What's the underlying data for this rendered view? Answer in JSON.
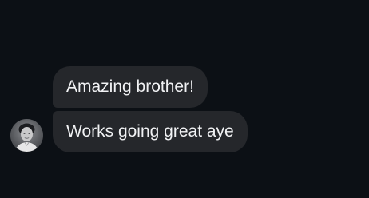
{
  "messages": [
    {
      "text": "Amazing brother!"
    },
    {
      "text": "Works going great aye"
    }
  ],
  "sender": {
    "avatar_icon": "person-photo-avatar"
  },
  "colors": {
    "background": "#0c1015",
    "bubble": "#25272b",
    "text": "#f1f2f4"
  }
}
